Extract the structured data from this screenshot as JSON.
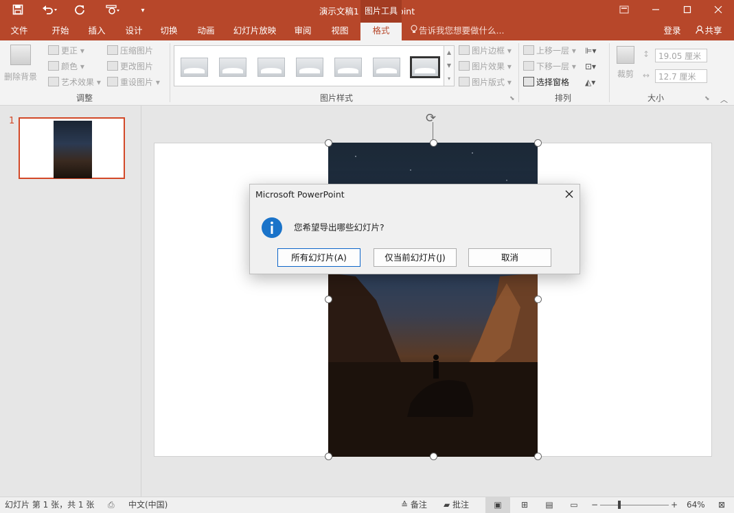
{
  "app": {
    "title": "演示文稿1 - PowerPoint",
    "context_tab": "图片工具",
    "colors": {
      "accent": "#b7472a",
      "selection_border": "#d24726",
      "info_icon": "#1a73c9"
    }
  },
  "quick_access": {
    "icons": [
      "save-icon",
      "undo-icon",
      "redo-icon",
      "touch-mode-icon",
      "customize-icon"
    ]
  },
  "window_controls": [
    "ribbon-display-icon",
    "minimize-icon",
    "maximize-icon",
    "close-icon"
  ],
  "ribbon_tabs": [
    "文件",
    "开始",
    "插入",
    "设计",
    "切换",
    "动画",
    "幻灯片放映",
    "审阅",
    "视图",
    "格式"
  ],
  "active_tab": "格式",
  "tell_me": "告诉我您想要做什么...",
  "account": {
    "signin": "登录",
    "share": "共享"
  },
  "ribbon": {
    "adjust": {
      "remove_bg": "删除背景",
      "corrections": "更正",
      "color": "颜色",
      "artistic": "艺术效果",
      "compress": "压缩图片",
      "change": "更改图片",
      "reset": "重设图片",
      "label": "调整"
    },
    "styles": {
      "label": "图片样式",
      "border": "图片边框",
      "effects": "图片效果",
      "layout": "图片版式"
    },
    "arrange": {
      "label": "排列",
      "forward": "上移一层",
      "backward": "下移一层",
      "selection_pane": "选择窗格"
    },
    "size": {
      "label": "大小",
      "crop": "裁剪",
      "height": "19.05 厘米",
      "width": "12.7 厘米"
    }
  },
  "slides_panel": {
    "slide_number": "1"
  },
  "dialog": {
    "title": "Microsoft PowerPoint",
    "message": "您希望导出哪些幻灯片?",
    "buttons": [
      "所有幻灯片(A)",
      "仅当前幻灯片(J)",
      "取消"
    ]
  },
  "status": {
    "slide_info": "幻灯片 第 1 张，共 1 张",
    "language": "中文(中国)",
    "notes": "备注",
    "comments": "批注",
    "zoom": "64%"
  }
}
